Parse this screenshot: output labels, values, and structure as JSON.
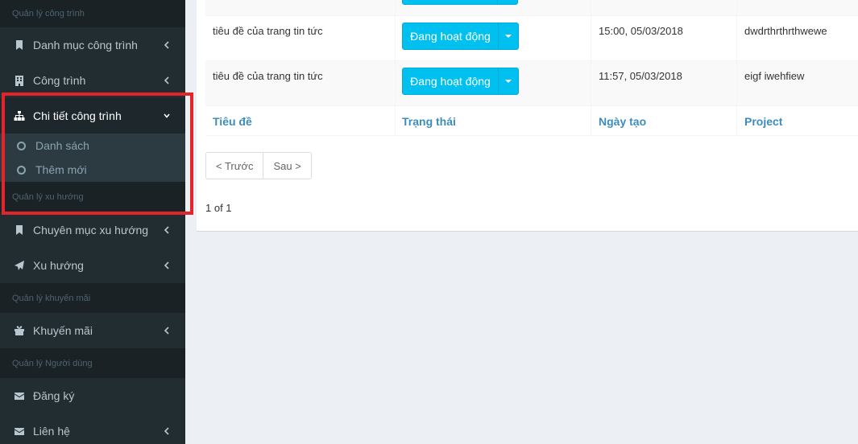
{
  "sidebar": {
    "headers": [
      "Quản lý công trình",
      "Quản lý xu hướng",
      "Quản lý khuyến mãi",
      "Quản lý Người dùng"
    ],
    "items": [
      {
        "label": "Danh mục công trình",
        "icon": "bookmark-icon"
      },
      {
        "label": "Công trình",
        "icon": "building-icon"
      },
      {
        "label": "Chi tiết công trình",
        "icon": "sitemap-icon"
      },
      {
        "label": "Chuyên mục xu hướng",
        "icon": "bookmark-icon"
      },
      {
        "label": "Xu hướng",
        "icon": "paper-plane-icon"
      },
      {
        "label": "Khuyến mãi",
        "icon": "gift-icon"
      },
      {
        "label": "Đăng ký",
        "icon": "envelope-icon"
      },
      {
        "label": "Liên hệ",
        "icon": "envelope-icon"
      }
    ],
    "subitems": [
      "Danh sách",
      "Thêm mới"
    ]
  },
  "table": {
    "rows": [
      {
        "title": "tiêu đề của trang tin tức",
        "status": "Đang hoạt động",
        "created": "15:00, 05/03/2018",
        "project": "dwdrthrthrthwewe"
      },
      {
        "title": "tiêu đề của trang tin tức",
        "status": "Đang hoạt động",
        "created": "11:57, 05/03/2018",
        "project": "eigf iwehfiew"
      }
    ],
    "footer": {
      "title": "Tiêu đề",
      "status": "Trạng thái",
      "created": "Ngày tạo",
      "project": "Project"
    }
  },
  "pagination": {
    "prev": "< Trước",
    "next": "Sau >",
    "info": "1 of 1"
  },
  "colors": {
    "sidebar_bg": "#222d32",
    "accent": "#00c0ef",
    "link": "#3c8dbc",
    "highlight": "#e3242b"
  }
}
